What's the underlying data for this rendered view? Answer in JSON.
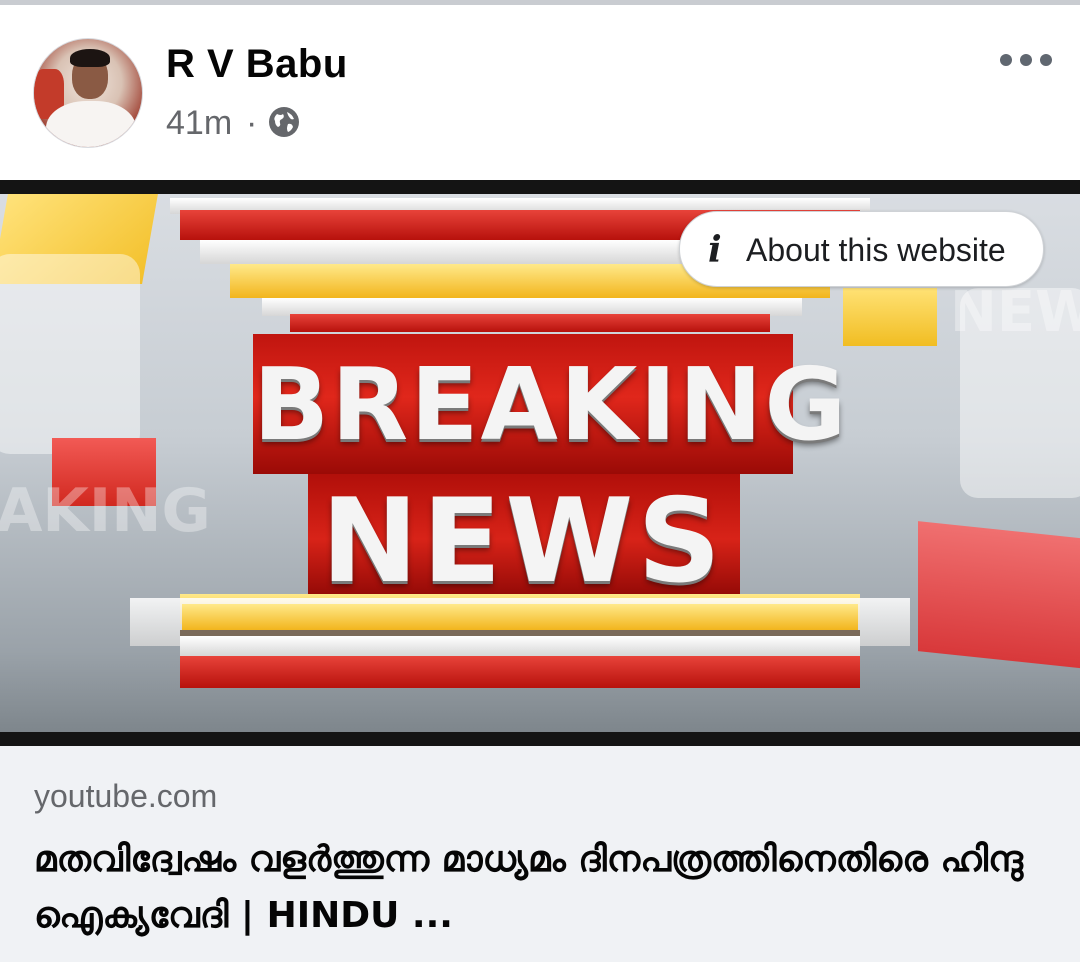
{
  "post": {
    "author_name": "R V Babu",
    "timestamp": "41m",
    "separator": "·",
    "audience_icon": "globe-icon",
    "more_icon": "more-options-icon"
  },
  "media": {
    "headline_line1": "BREAKING",
    "headline_line2": "NEWS",
    "ghost_left": "AKING",
    "ghost_right": "NEW",
    "about_label": "About this website",
    "about_icon": "info-icon"
  },
  "link_preview": {
    "domain": "youtube.com",
    "title": "മതവിദ്വേഷം വളർത്തുന്ന മാധ്യമം ദിനപത്രത്തിനെതിരെ ഹിന്ദു ഐക്യവേദി | HINDU ..."
  },
  "colors": {
    "text_primary": "#050505",
    "text_secondary": "#65676b",
    "preview_bg": "#f0f2f5",
    "accent_red": "#d82318"
  }
}
